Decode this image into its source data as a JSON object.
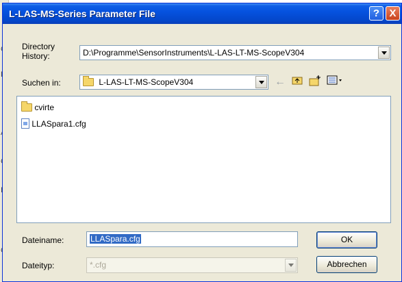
{
  "window": {
    "title": "L-LAS-MS-Series Parameter File",
    "help_glyph": "?",
    "close_glyph": "X"
  },
  "directory_history": {
    "label_line1": "Directory",
    "label_line2": "History:",
    "value": "D:\\Programme\\SensorInstruments\\L-LAS-LT-MS-ScopeV304"
  },
  "look_in": {
    "label": "Suchen in:",
    "value": "L-LAS-LT-MS-ScopeV304"
  },
  "toolbar": {
    "back_icon": "back-arrow-icon",
    "up_icon": "up-folder-icon",
    "new_folder_icon": "new-folder-icon",
    "view_icon": "view-menu-icon"
  },
  "files": [
    {
      "name": "cvirte",
      "type": "folder"
    },
    {
      "name": "LLASpara1.cfg",
      "type": "file"
    }
  ],
  "filename": {
    "label": "Dateiname:",
    "value": "LLASpara.cfg"
  },
  "filetype": {
    "label": "Dateityp:",
    "value": "*.cfg"
  },
  "buttons": {
    "ok": "OK",
    "cancel": "Abbrechen"
  }
}
